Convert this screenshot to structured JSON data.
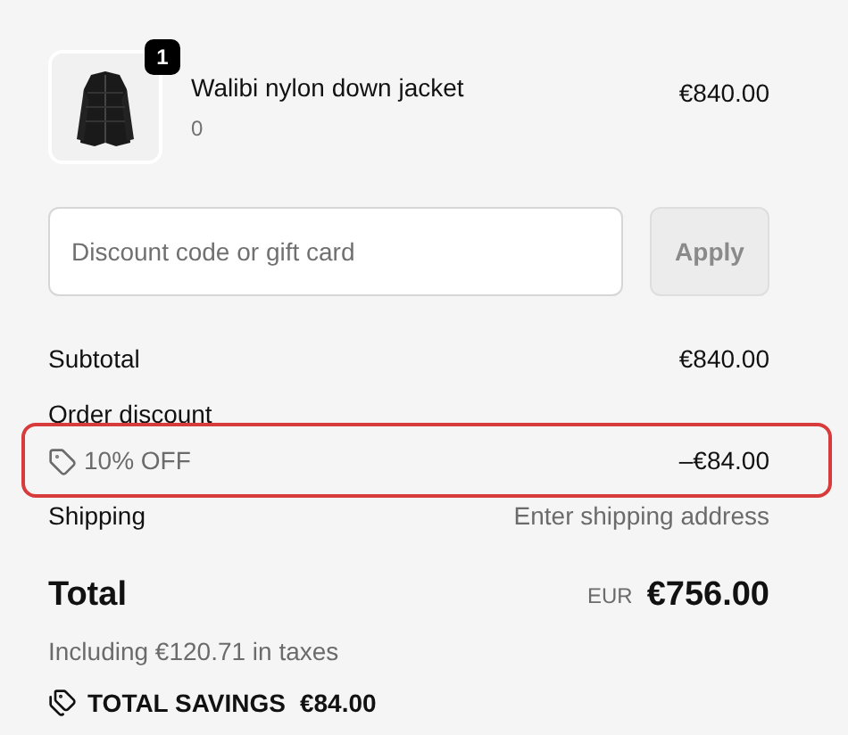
{
  "item": {
    "quantity": "1",
    "name": "Walibi nylon down jacket",
    "variant": "0",
    "price": "€840.00"
  },
  "discount_field": {
    "placeholder": "Discount code or gift card"
  },
  "apply_button": {
    "label": "Apply",
    "disabled": true
  },
  "summary": {
    "subtotal_label": "Subtotal",
    "subtotal": "€840.00",
    "discount_label": "Order discount",
    "discount_line": {
      "code": "10% OFF",
      "amount": "–€84.00",
      "highlighted": true
    },
    "shipping_label": "Shipping",
    "shipping": "Enter shipping address"
  },
  "total": {
    "label": "Total",
    "currency": "EUR",
    "amount": "€756.00",
    "taxes": "Including €120.71 in taxes",
    "savings_label": "TOTAL SAVINGS",
    "savings": "€84.00"
  }
}
